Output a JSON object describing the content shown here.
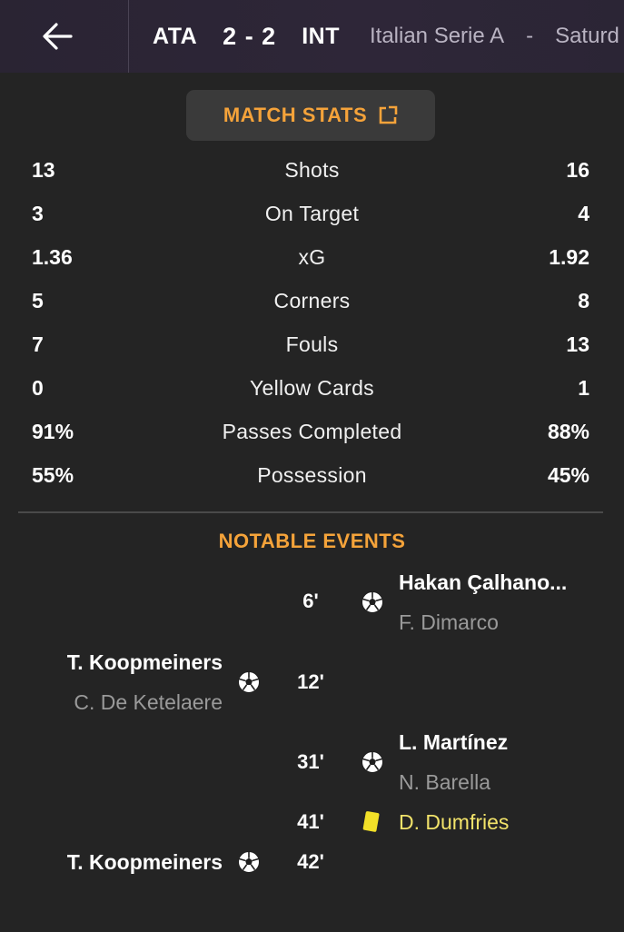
{
  "header": {
    "home_team": "ATA",
    "score": "2 - 2",
    "away_team": "INT",
    "competition": "Italian Serie A",
    "separator": "-",
    "date_fragment": "Saturd"
  },
  "match_stats_button": {
    "label": "MATCH STATS"
  },
  "stats": [
    {
      "home": "13",
      "label": "Shots",
      "away": "16"
    },
    {
      "home": "3",
      "label": "On Target",
      "away": "4"
    },
    {
      "home": "1.36",
      "label": "xG",
      "away": "1.92"
    },
    {
      "home": "5",
      "label": "Corners",
      "away": "8"
    },
    {
      "home": "7",
      "label": "Fouls",
      "away": "13"
    },
    {
      "home": "0",
      "label": "Yellow Cards",
      "away": "1"
    },
    {
      "home": "91%",
      "label": "Passes Completed",
      "away": "88%"
    },
    {
      "home": "55%",
      "label": "Possession",
      "away": "45%"
    }
  ],
  "notable_events": {
    "title": "NOTABLE EVENTS",
    "events": [
      {
        "minute": "6'",
        "side": "away",
        "type": "goal",
        "scorer": "Hakan Çalhano...",
        "assist": "F. Dimarco"
      },
      {
        "minute": "12'",
        "side": "home",
        "type": "goal",
        "scorer": "T. Koopmeiners",
        "assist": "C. De Ketelaere"
      },
      {
        "minute": "31'",
        "side": "away",
        "type": "goal",
        "scorer": "L. Martínez",
        "assist": "N. Barella"
      },
      {
        "minute": "41'",
        "side": "away",
        "type": "yellow-card",
        "player": "D. Dumfries"
      },
      {
        "minute": "42'",
        "side": "home",
        "type": "goal",
        "scorer": "T. Koopmeiners"
      }
    ]
  },
  "colors": {
    "accent": "#f5a33a",
    "background": "#242424",
    "header_bg": "#2e2638",
    "yellow_card": "#f2e36a",
    "muted_text": "#9a9a9a"
  },
  "icons": {
    "back": "arrow-left-icon",
    "expand": "expand-icon",
    "goal": "football-icon",
    "card": "yellow-card-icon"
  }
}
